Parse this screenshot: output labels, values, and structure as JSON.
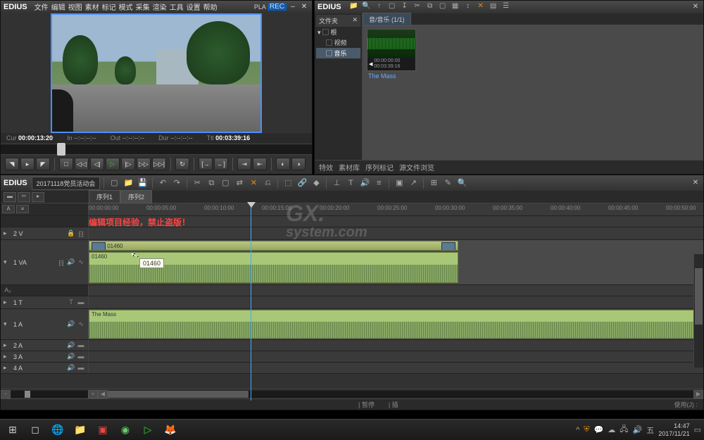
{
  "app_name": "EDIUS",
  "menu": [
    "文件",
    "编辑",
    "视图",
    "素材",
    "标记",
    "模式",
    "采集",
    "渲染",
    "工具",
    "设置",
    "帮助"
  ],
  "rec_label": "PLA REC",
  "window_ctrls": {
    "min": "–",
    "close": "✕"
  },
  "timecode": {
    "cur_label": "Cur",
    "cur": "00:00:13:20",
    "in_label": "In",
    "in": "--:--:--:--",
    "out_label": "Out",
    "out": "--:--:--:--",
    "dur_label": "Dur",
    "dur": "--:--:--:--",
    "ttl_label": "Ttl",
    "ttl": "00:03:39:16"
  },
  "transport": {
    "step_back": "❘◁",
    "mark_in": "▢",
    "mark_out": "◁",
    "prev": "|◁◁",
    "rew": "◁◁",
    "back": "◁|",
    "play": "▷",
    "fwd": "|▷",
    "ff": "▷▷",
    "next": "▷▷|",
    "loop": "⟲",
    "in_btn": "[→",
    "out_btn": "←]",
    "jog1": "⤴",
    "jog2": "⤵"
  },
  "bin": {
    "tree_header": "文件夹",
    "tree_close": "✕",
    "root_label": "根",
    "items": [
      "视频",
      "音乐"
    ],
    "tab_label": "音/音乐 (1/1)",
    "clip_name": "The Mass",
    "clip_tc1": "00:00:00:00",
    "clip_tc2": "00:03:39:16",
    "bottom_tabs": [
      "特效",
      "素材库",
      "序列标记",
      "源文件浏览"
    ]
  },
  "timeline": {
    "project": "20171118党员活动会",
    "seq_tabs": [
      "序列1",
      "序列2"
    ],
    "ruler": [
      "00:00:00:00",
      "00:00:05:00",
      "00:00:10:00",
      "00:00:15:00",
      "00:00:20:00",
      "00:00:25:00",
      "00:00:30:00",
      "00:00:35:00",
      "00:00:40:00",
      "00:00:45:00",
      "00:00:50:00"
    ],
    "tracks": [
      {
        "name": "2 V",
        "type": "v"
      },
      {
        "name": "1 VA",
        "type": "va"
      },
      {
        "name": "1 T",
        "type": "t"
      },
      {
        "name": "1 A",
        "type": "a"
      },
      {
        "name": "2 A",
        "type": "a"
      },
      {
        "name": "3 A",
        "type": "a"
      },
      {
        "name": "4 A",
        "type": "a"
      }
    ],
    "warning_text": "编辑项目经验，禁止盗版！",
    "video_clip": "01460",
    "audio_clip": "01460",
    "tooltip": "01460",
    "music_clip": "The Mass",
    "watermark1": "GX.",
    "watermark2": "system.com"
  },
  "status": {
    "pause": "| 暂停",
    "ins": "| 插",
    "use": "使用(J) :"
  },
  "taskbar": {
    "time": "14:47",
    "date": "2017/11/21",
    "ime": "五",
    "arrow": "^"
  }
}
